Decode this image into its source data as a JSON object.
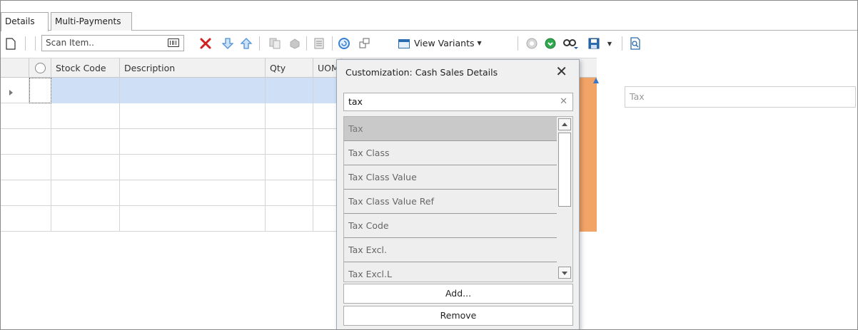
{
  "tabs": [
    {
      "label": "Details"
    },
    {
      "label": "Multi-Payments"
    }
  ],
  "toolbar": {
    "scan_placeholder": "Scan Item..",
    "view_variants_label": "View Variants"
  },
  "grid": {
    "columns": [
      {
        "label": "Stock Code"
      },
      {
        "label": "Description"
      },
      {
        "label": "Qty"
      },
      {
        "label": "UOM"
      }
    ],
    "row_count": 6
  },
  "side_field": {
    "placeholder": "Tax"
  },
  "popup": {
    "title": "Customization: Cash Sales Details",
    "search_value": "tax",
    "items": [
      {
        "label": "Tax"
      },
      {
        "label": "Tax Class"
      },
      {
        "label": "Tax Class Value"
      },
      {
        "label": "Tax Class Value Ref"
      },
      {
        "label": "Tax Code"
      },
      {
        "label": "Tax Excl."
      },
      {
        "label": "Tax Excl.L"
      }
    ],
    "add_label": "Add...",
    "remove_label": "Remove"
  },
  "colors": {
    "accent_orange": "#f2a366",
    "selected_row": "#cfe0f6",
    "delete_red": "#d11f1f",
    "arrow_blue": "#4a8fd8"
  },
  "icons": [
    "new-doc-icon",
    "barcode-icon",
    "delete-icon",
    "move-down-icon",
    "move-up-icon",
    "copy-icon",
    "paste-icon",
    "list-icon",
    "refresh-icon",
    "window-icon",
    "view-variants-icon",
    "circle-gray-icon",
    "circle-green-icon",
    "binoculars-icon",
    "save-icon",
    "preview-icon"
  ]
}
